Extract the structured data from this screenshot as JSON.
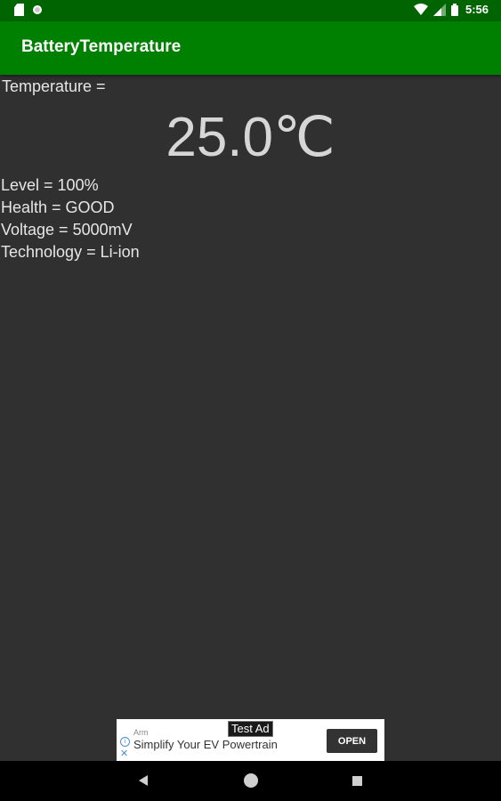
{
  "status_bar": {
    "time": "5:56",
    "icons": [
      "sd-card-icon",
      "notification-dot-icon",
      "wifi-icon",
      "signal-icon",
      "battery-icon"
    ]
  },
  "app_bar": {
    "title": "BatteryTemperature",
    "color": "#008000"
  },
  "temperature": {
    "label": "Temperature =",
    "value": "25.0℃"
  },
  "details": {
    "level": "Level = 100%",
    "health": "Health = GOOD",
    "voltage": "Voltage = 5000mV",
    "technology": "Technology = Li-ion"
  },
  "ad": {
    "badge": "Test Ad",
    "sponsor": "Arm",
    "headline": "Simplify Your EV Powertrain",
    "button": "OPEN",
    "info_icon": "i",
    "close_icon": "✕"
  },
  "nav_bar": {
    "buttons": [
      "back-icon",
      "home-icon",
      "recents-icon"
    ]
  },
  "colors": {
    "background": "#303030",
    "status_bar": "#006400",
    "text": "#e6e6e6"
  }
}
